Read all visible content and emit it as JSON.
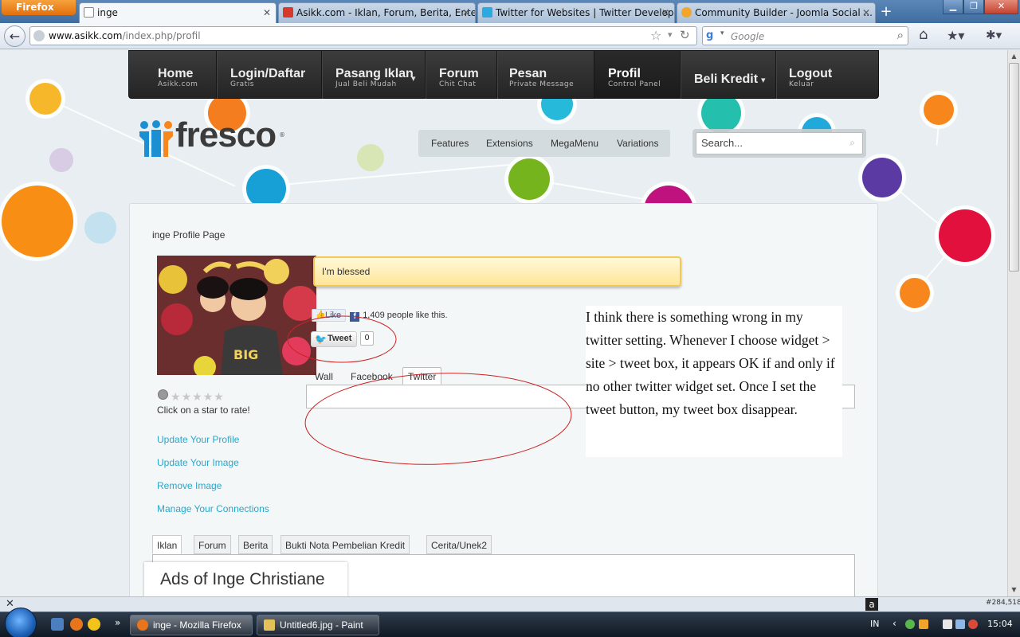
{
  "browser": {
    "menu_button": "Firefox",
    "tabs": [
      {
        "label": "inge",
        "active": true
      },
      {
        "label": "Asikk.com - Iklan, Forum, Berita, Ente...",
        "active": false
      },
      {
        "label": "Twitter for Websites | Twitter Develop...",
        "active": false
      },
      {
        "label": "Community Builder - Joomla Social ...",
        "active": false
      }
    ],
    "url_host": "www.asikk.com",
    "url_path": "/index.php/profil",
    "search_placeholder": "Google",
    "addon_coords": "#284,518"
  },
  "site": {
    "main_menu": [
      {
        "title": "Home",
        "sub": "Asikk.com"
      },
      {
        "title": "Login/Daftar",
        "sub": "Gratis"
      },
      {
        "title": "Pasang Iklan",
        "sub": "Jual Beli Mudah",
        "caret": true
      },
      {
        "title": "Forum",
        "sub": "Chit Chat"
      },
      {
        "title": "Pesan",
        "sub": "Private Message"
      },
      {
        "title": "Profil",
        "sub": "Control Panel",
        "active": true
      },
      {
        "title": "Beli Kredit",
        "sub": "",
        "caret": true
      },
      {
        "title": "Logout",
        "sub": "Keluar"
      }
    ],
    "logo_text": "fresco",
    "sub_menu": [
      "Features",
      "Extensions",
      "MegaMenu",
      "Variations"
    ],
    "search_placeholder": "Search..."
  },
  "profile": {
    "heading": "inge Profile Page",
    "status": "I'm blessed",
    "rating_text": "Click on a star to rate!",
    "rating_value": 0,
    "links": [
      "Update Your Profile",
      "Update Your Image",
      "Remove Image",
      "Manage Your Connections"
    ],
    "fb_like_label": "Like",
    "fb_like_count_text": "1,409 people like this.",
    "tweet_label": "Tweet",
    "tweet_count": "0",
    "social_tabs": [
      "Wall",
      "Facebook",
      "Twitter"
    ],
    "social_active": "Twitter",
    "bottom_tabs": [
      "Iklan",
      "Forum",
      "Berita",
      "Bukti Nota Pembelian Kredit",
      "Cerita/Unek2"
    ],
    "bottom_active": "Iklan",
    "ads_title": "Ads of Inge Christiane"
  },
  "annotation": {
    "text": "I think there is something wrong in my twitter setting. Whenever I choose widget > site > tweet box, it appears OK if and only if no other twitter widget set. Once I set the tweet button, my tweet box disappear."
  },
  "taskbar": {
    "tasks": [
      "inge - Mozilla Firefox",
      "Untitled6.jpg - Paint"
    ],
    "lang": "IN",
    "clock": "15:04"
  },
  "colors": {
    "menu_bg": "#2e2e2e",
    "link": "#2aa7c9",
    "status_bg": "#ffe699",
    "annotation_circle": "#cc2222"
  }
}
